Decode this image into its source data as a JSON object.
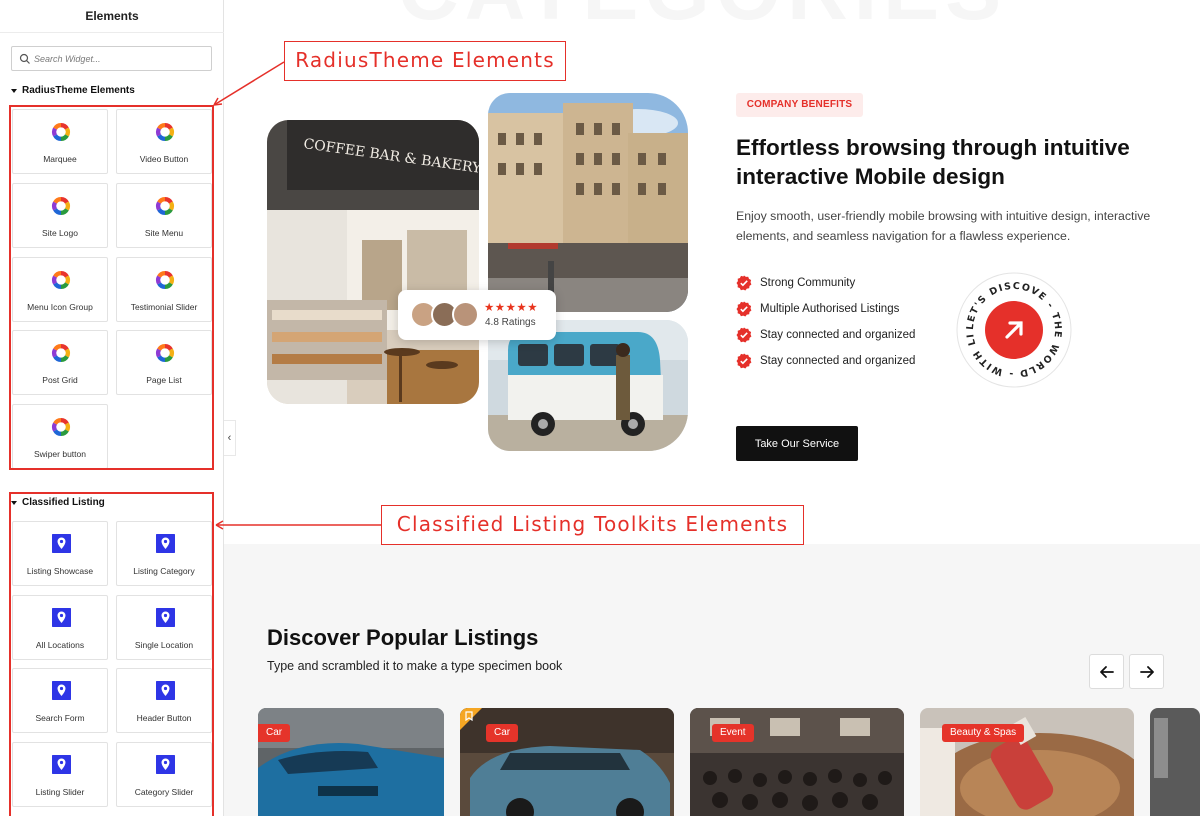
{
  "sidebar": {
    "title": "Elements",
    "search_placeholder": "Search Widget...",
    "radius_category": "RadiusTheme Elements",
    "radius_widgets": [
      "Marquee",
      "Video Button",
      "Site Logo",
      "Site Menu",
      "Menu Icon Group",
      "Testimonial Slider",
      "Post Grid",
      "Page List",
      "Swiper button"
    ],
    "classified_category": "Classified Listing",
    "classified_widgets": [
      "Listing Showcase",
      "Listing Category",
      "All Locations",
      "Single Location",
      "Search Form",
      "Header Button",
      "Listing Slider",
      "Category Slider"
    ],
    "collapse_icon": "‹"
  },
  "annotations": {
    "radius_callout": "RadiusTheme Elements",
    "classified_callout": "Classified Listing Toolkits Elements",
    "accent": "#e5302a"
  },
  "hero": {
    "ghost_text": "CATEGORIES",
    "storefront_sign": "COFFEE BAR & BAKERY",
    "rating_stars": "★★★★★",
    "rating_text": "4.8 Ratings",
    "badge": "COMPANY BENEFITS",
    "headline": "Effortless browsing through intuitive interactive Mobile design",
    "description": "Enjoy smooth, user-friendly mobile browsing with intuitive design, interactive elements, and seamless navigation for a flawless experience.",
    "benefits": [
      "Strong Community",
      "Multiple Authorised Listings",
      "Stay connected and organized",
      "Stay connected and organized"
    ],
    "button": "Take Our Service",
    "circle_text": "LET'S DISCOVE - THE WORLD - WITH LISTPRESS - THEME - "
  },
  "listings": {
    "title": "Discover Popular Listings",
    "subtitle": "Type and scrambled it to make a type specimen book",
    "prev_icon": "arrow-left-icon",
    "next_icon": "arrow-right-icon",
    "cards": [
      {
        "tag": "Car"
      },
      {
        "tag": "Car"
      },
      {
        "tag": "Event"
      },
      {
        "tag": "Beauty & Spas"
      }
    ]
  }
}
